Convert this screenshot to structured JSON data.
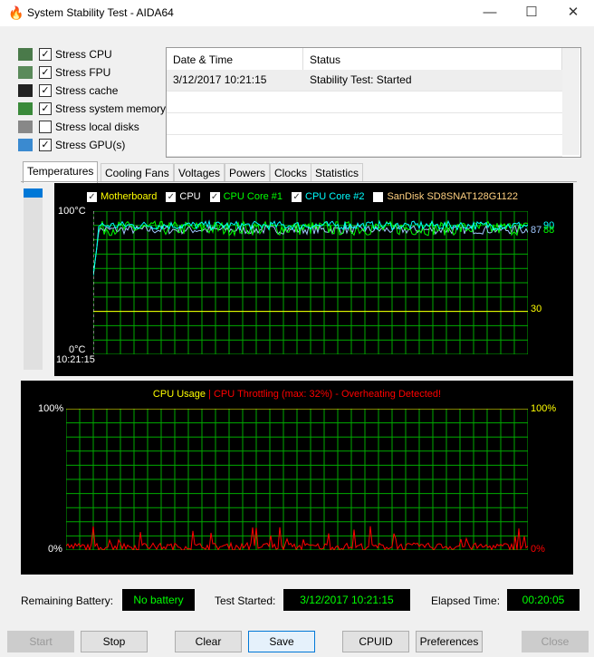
{
  "window": {
    "title": "System Stability Test - AIDA64",
    "min": "—",
    "max": "☐",
    "close": "✕"
  },
  "options": [
    {
      "label": "Stress CPU",
      "checked": true,
      "icon": "cpu-icon"
    },
    {
      "label": "Stress FPU",
      "checked": true,
      "icon": "fpu-icon"
    },
    {
      "label": "Stress cache",
      "checked": true,
      "icon": "cache-icon"
    },
    {
      "label": "Stress system memory",
      "checked": true,
      "icon": "memory-icon"
    },
    {
      "label": "Stress local disks",
      "checked": false,
      "icon": "disk-icon"
    },
    {
      "label": "Stress GPU(s)",
      "checked": true,
      "icon": "gpu-icon"
    }
  ],
  "log": {
    "headers": [
      "Date & Time",
      "Status"
    ],
    "rows": [
      [
        "3/12/2017 10:21:15",
        "Stability Test: Started"
      ]
    ]
  },
  "tabs": [
    "Temperatures",
    "Cooling Fans",
    "Voltages",
    "Powers",
    "Clocks",
    "Statistics"
  ],
  "chart_data": [
    {
      "type": "line",
      "title": "Temperatures",
      "ylabel": "°C",
      "ylim": [
        0,
        100
      ],
      "y_top_label": "100°C",
      "y_bottom_label": "0°C",
      "x_start_label": "10:21:15",
      "grid": true,
      "legend": [
        {
          "name": "Motherboard",
          "checked": true,
          "color": "#ffff00"
        },
        {
          "name": "CPU",
          "checked": true,
          "color": "#ffffff"
        },
        {
          "name": "CPU Core #1",
          "checked": true,
          "color": "#00ff00"
        },
        {
          "name": "CPU Core #2",
          "checked": true,
          "color": "#00ffff"
        },
        {
          "name": "SanDisk SD8SNAT128G1122",
          "checked": false,
          "color": "#ffd080"
        }
      ],
      "series": [
        {
          "name": "Motherboard",
          "current": 30,
          "color": "#ffff00"
        },
        {
          "name": "CPU",
          "current": 87,
          "color": "#a0c8ff"
        },
        {
          "name": "CPU Core #1",
          "current": 88,
          "color": "#00ff00"
        },
        {
          "name": "CPU Core #2",
          "current": 90,
          "color": "#00ffff"
        }
      ],
      "current_labels": [
        "30",
        "87",
        "90",
        "88"
      ]
    },
    {
      "type": "line",
      "title": "CPU Usage",
      "subtitle": "CPU Throttling (max: 32%) - Overheating Detected!",
      "separator": "|",
      "ylim": [
        0,
        100
      ],
      "y_labels": [
        "100%",
        "0%"
      ],
      "grid": true,
      "series": [
        {
          "name": "CPU Usage",
          "color": "#ffff00",
          "current": 100
        },
        {
          "name": "CPU Throttling",
          "color": "#ff0000",
          "max": 32,
          "typical": 5
        }
      ]
    }
  ],
  "statusbar": {
    "battery_label": "Remaining Battery:",
    "battery": "No battery",
    "started_label": "Test Started:",
    "started": "3/12/2017 10:21:15",
    "elapsed_label": "Elapsed Time:",
    "elapsed": "00:20:05"
  },
  "buttons": {
    "start": "Start",
    "stop": "Stop",
    "clear": "Clear",
    "save": "Save",
    "cpuid": "CPUID",
    "preferences": "Preferences",
    "close": "Close"
  }
}
